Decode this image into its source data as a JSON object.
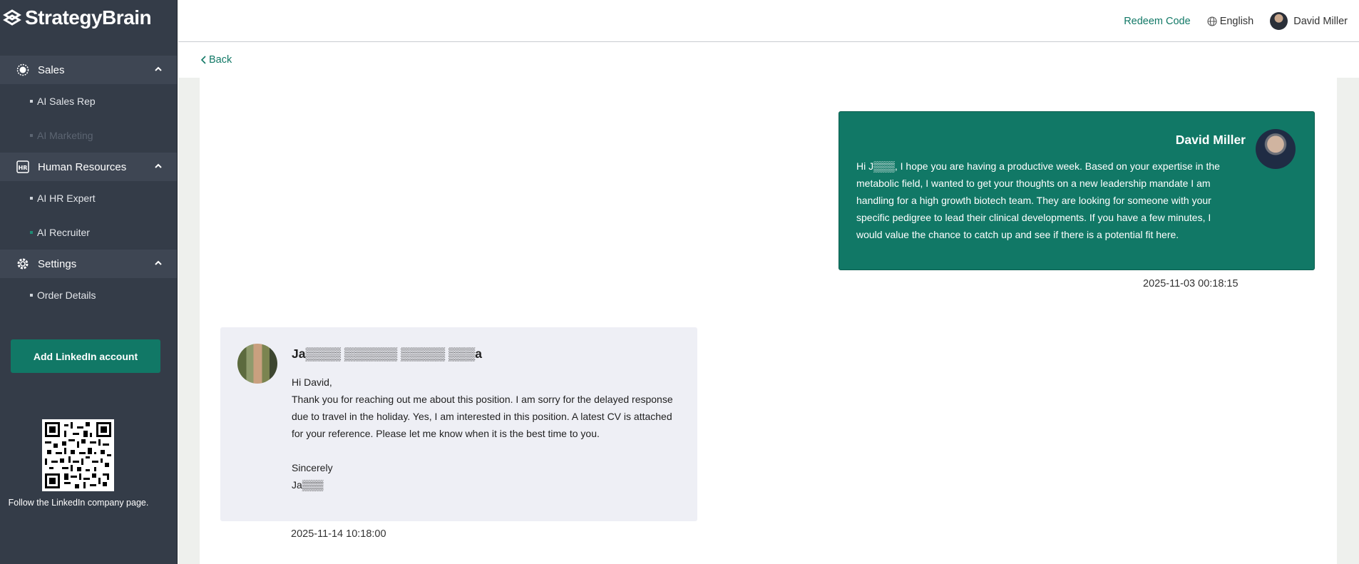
{
  "app": {
    "brand": "StrategyBrain"
  },
  "header": {
    "redeem_label": "Redeem Code",
    "language_label": "English",
    "user_name": "David Miller"
  },
  "sidebar": {
    "groups": [
      {
        "label": "Sales",
        "icon": "sales-badge-icon",
        "items": [
          {
            "label": "AI Sales Rep",
            "state": "normal"
          },
          {
            "label": "AI Marketing",
            "state": "disabled"
          }
        ]
      },
      {
        "label": "Human Resources",
        "icon": "hr-icon",
        "items": [
          {
            "label": "AI HR Expert",
            "state": "normal"
          },
          {
            "label": "AI Recruiter",
            "state": "active"
          }
        ]
      },
      {
        "label": "Settings",
        "icon": "gear-icon",
        "items": [
          {
            "label": "Order Details",
            "state": "normal"
          }
        ]
      }
    ],
    "linkedin_button": "Add LinkedIn account",
    "follow_text": "Follow the LinkedIn company page."
  },
  "content": {
    "back_label": "Back",
    "outgoing": {
      "sender": "David Miller",
      "text": "Hi J▒▒▒, I hope you are having a productive week. Based on your expertise in the metabolic field, I wanted to get your thoughts on a new leadership mandate I am handling for a high growth biotech team. They are looking for someone with your specific pedigree to lead their clinical developments. If you have a few minutes, I would value the chance to catch up and see if there is a potential fit here.",
      "timestamp": "2025-11-03 00:18:15"
    },
    "incoming": {
      "sender": "Ja▒▒▒▒ ▒▒▒▒▒▒ ▒▒▒▒▒ ▒▒▒a",
      "text": "Hi David,\n Thank you for reaching out me about this position. I am sorry for the delayed response due to travel in the holiday. Yes, I am interested in this position. A latest CV is attached for your reference. Please let me know when it is the best time to you.\n\nSincerely\nJa▒▒▒",
      "timestamp": "2025-11-14 10:18:00"
    }
  },
  "colors": {
    "sidebar_bg": "#343c48",
    "accent": "#117866",
    "incoming_bg": "#eeeff5"
  }
}
